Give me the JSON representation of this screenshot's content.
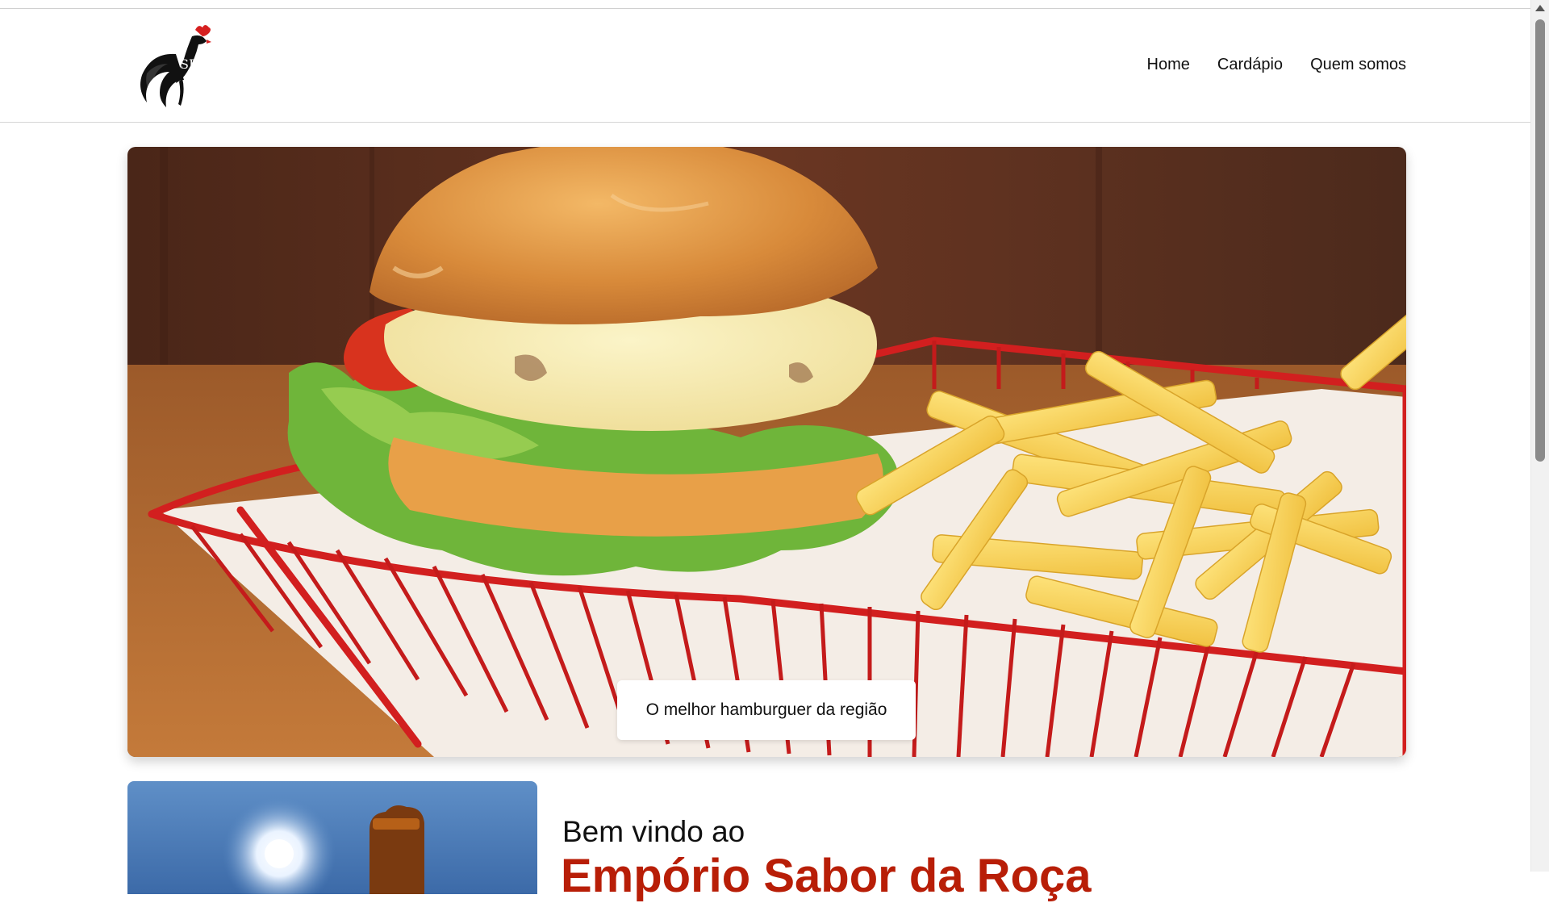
{
  "nav": {
    "items": [
      {
        "label": "Home"
      },
      {
        "label": "Cardápio"
      },
      {
        "label": "Quem somos"
      }
    ]
  },
  "logo": {
    "icon": "rooster-logo-icon",
    "monogram": "SR"
  },
  "hero": {
    "caption": "O melhor hamburguer da região"
  },
  "intro": {
    "welcome": "Bem vindo ao",
    "brand": "Empório Sabor da Roça"
  },
  "colors": {
    "brand_red": "#b81e07",
    "basket_red": "#d21f1f"
  }
}
